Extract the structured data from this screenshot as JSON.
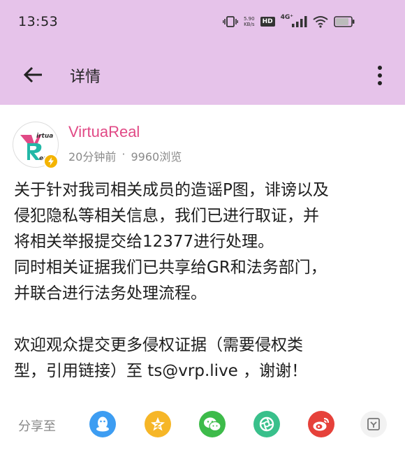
{
  "status_bar": {
    "time": "13:53",
    "net_speed_value": "5.90",
    "net_speed_unit": "KB/s",
    "hd_label": "HD",
    "signal_label": "4G⁺",
    "battery_level": "87"
  },
  "app_bar": {
    "title": "详情"
  },
  "post": {
    "author": "VirtuaReal",
    "time_ago": "20分钟前",
    "separator": "·",
    "views": "9960浏览",
    "content": "关于针对我司相关成员的造谣P图，诽谤以及\n侵犯隐私等相关信息，我们已进行取证，并\n将相关举报提交给12377进行处理。\n同时相关证据我们已共享给GR和法务部门，\n并联合进行法务处理流程。\n\n欢迎观众提交更多侵权证据（需要侵权类\n型，引用链接）至 ts@vrp.live ，谢谢！"
  },
  "share": {
    "label": "分享至",
    "targets": [
      "qq",
      "qzone",
      "wechat",
      "moments",
      "weibo",
      "more"
    ]
  },
  "colors": {
    "header_bg": "#e6c3ea",
    "author_color": "#e14a86",
    "qq": "#3d9df2",
    "qzone": "#f6b627",
    "wechat": "#3dbb4a",
    "moments": "#39c08b",
    "weibo": "#e6413a"
  }
}
